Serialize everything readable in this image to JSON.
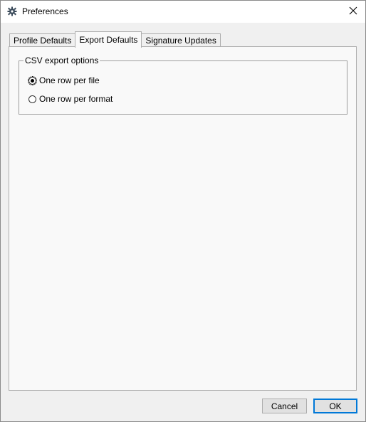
{
  "window": {
    "title": "Preferences",
    "app_icon": "gear-icon",
    "close_icon": "close-icon"
  },
  "tabs": [
    {
      "label": "Profile Defaults",
      "active": false
    },
    {
      "label": "Export Defaults",
      "active": true
    },
    {
      "label": "Signature Updates",
      "active": false
    }
  ],
  "csv_group": {
    "title": "CSV export options",
    "options": [
      {
        "label": "One row per file",
        "selected": true
      },
      {
        "label": "One row per format",
        "selected": false
      }
    ]
  },
  "buttons": {
    "cancel_label": "Cancel",
    "ok_label": "OK"
  },
  "colors": {
    "accent": "#0078d7",
    "panel_bg": "#f9f9f9",
    "window_bg": "#f0f0f0"
  }
}
